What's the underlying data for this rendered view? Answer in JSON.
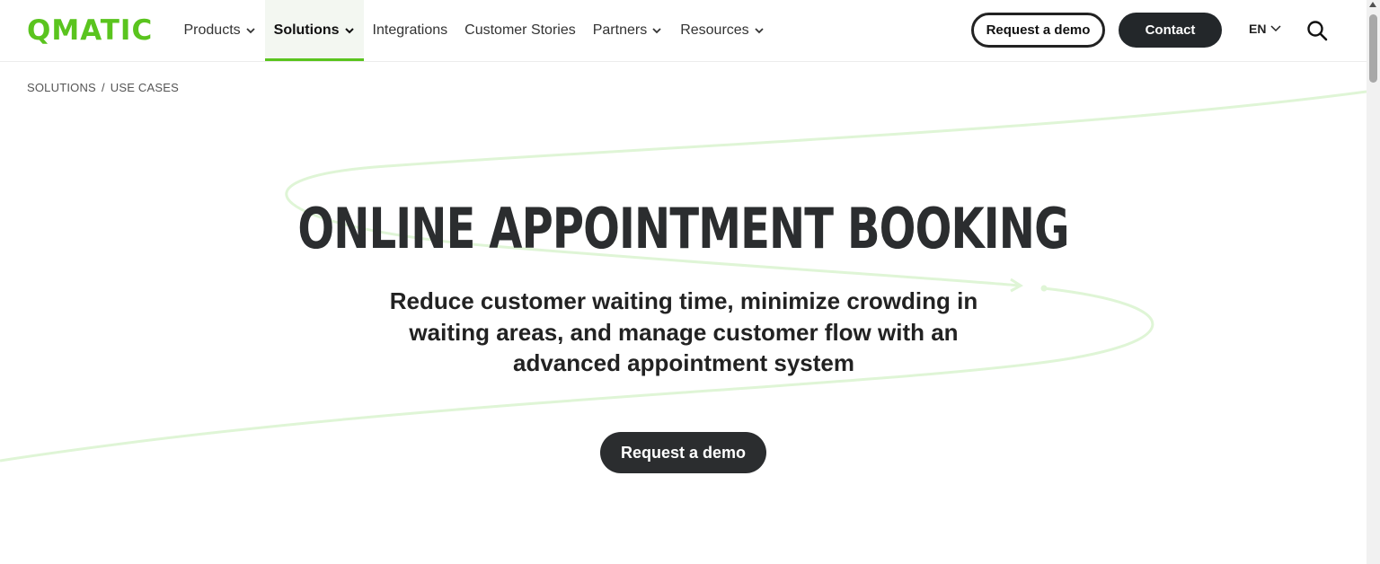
{
  "brand": {
    "logo_text": "QMATIC",
    "accent": "#5ac41e"
  },
  "nav": {
    "items": [
      {
        "label": "Products",
        "has_dropdown": true
      },
      {
        "label": "Solutions",
        "has_dropdown": true,
        "active": true
      },
      {
        "label": "Integrations",
        "has_dropdown": false
      },
      {
        "label": "Customer Stories",
        "has_dropdown": false
      },
      {
        "label": "Partners",
        "has_dropdown": true
      },
      {
        "label": "Resources",
        "has_dropdown": true
      }
    ]
  },
  "header": {
    "demo_label": "Request a demo",
    "contact_label": "Contact",
    "language": "EN",
    "icons": {
      "search": "search-icon",
      "language_dropdown": "chevron-down-icon"
    }
  },
  "breadcrumb": {
    "items": [
      "SOLUTIONS",
      "USE CASES"
    ],
    "separator": "/"
  },
  "hero": {
    "title": "ONLINE APPOINTMENT BOOKING",
    "subtitle": "Reduce customer waiting time, minimize crowding in waiting areas, and manage customer flow with an advanced appointment system",
    "cta_label": "Request a demo",
    "colors": {
      "title": "#2b2d2f",
      "cta_bg": "#2b2d2f",
      "swoosh": "#dff5d6"
    }
  }
}
